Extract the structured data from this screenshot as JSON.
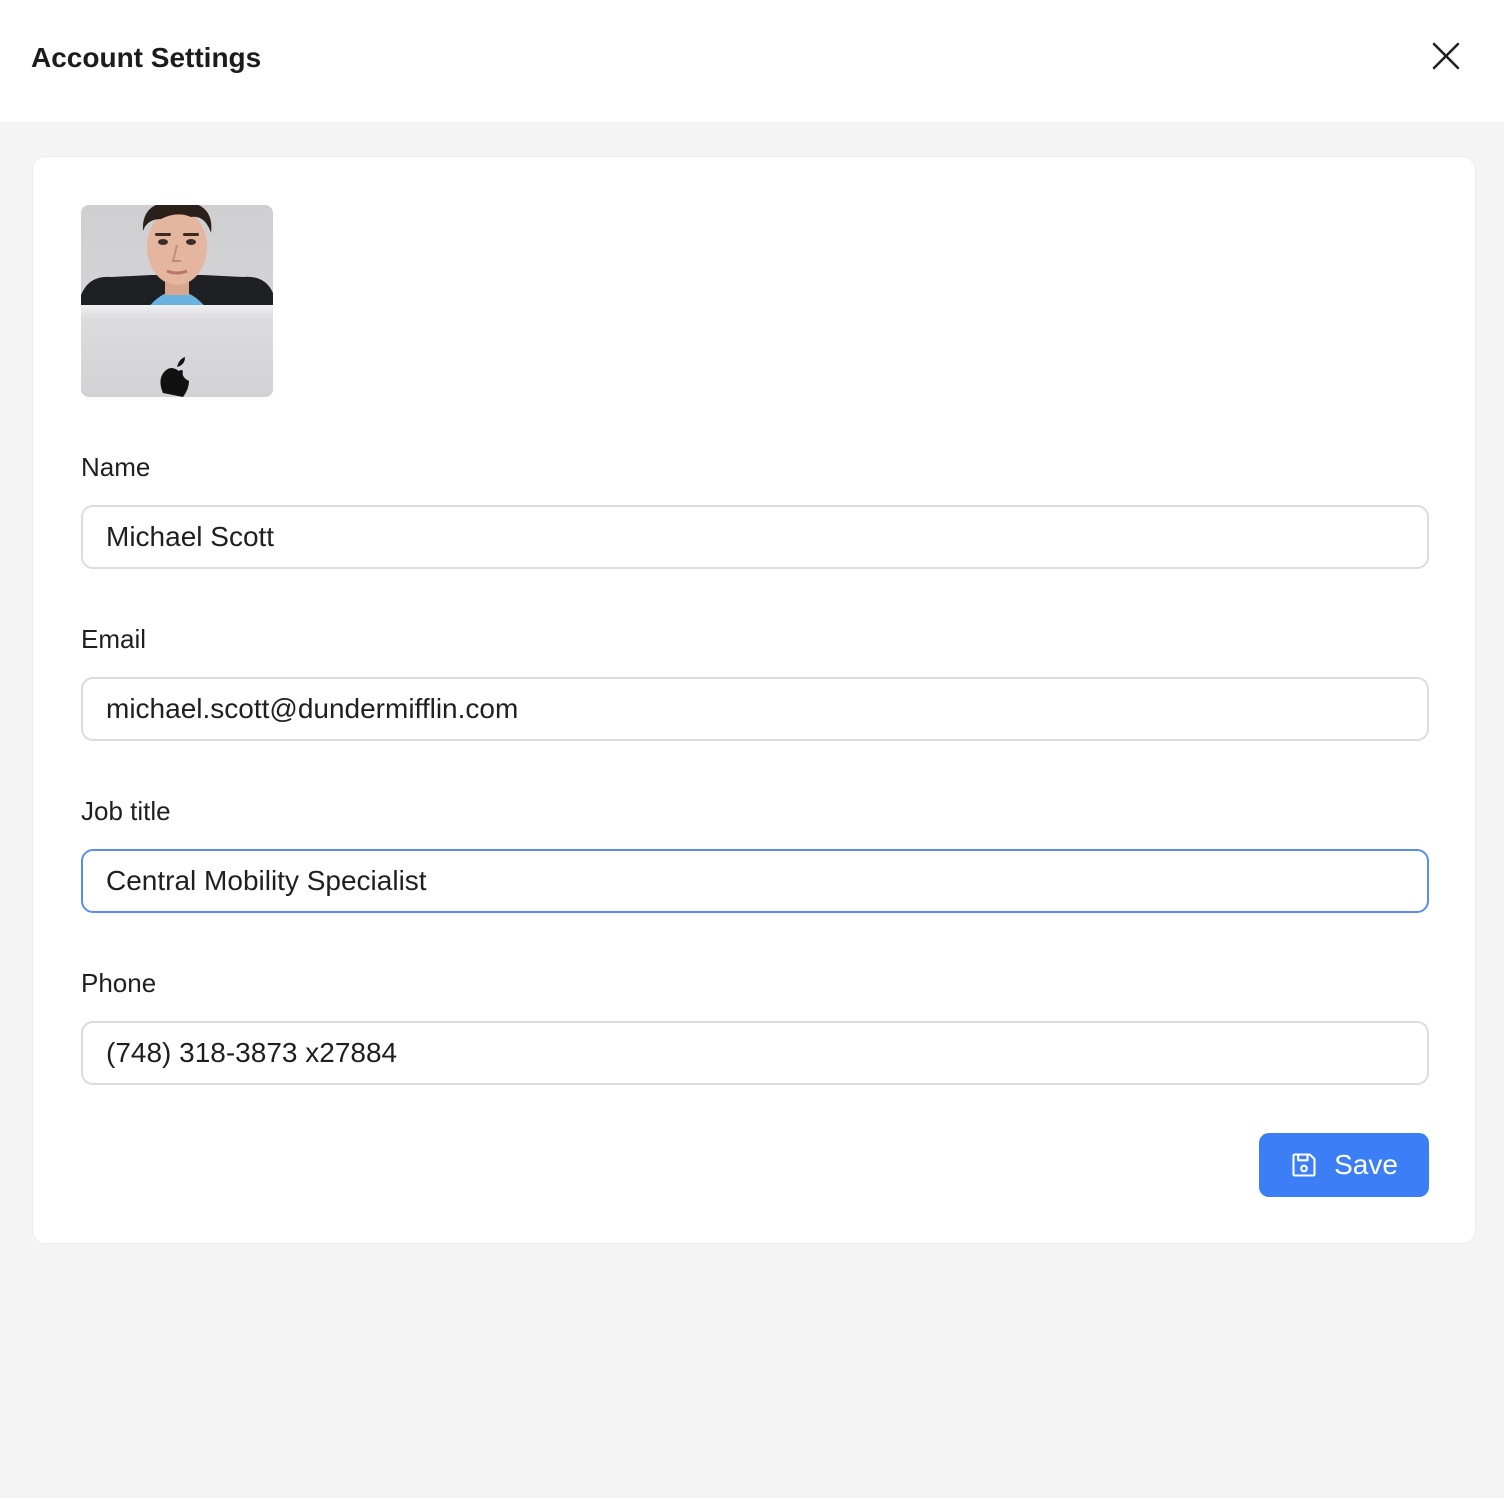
{
  "header": {
    "title": "Account Settings",
    "close_icon": "close-icon"
  },
  "profile": {
    "avatar_icon": "user-photo"
  },
  "fields": {
    "name": {
      "label": "Name",
      "value": "Michael Scott"
    },
    "email": {
      "label": "Email",
      "value": "michael.scott@dundermifflin.com"
    },
    "job_title": {
      "label": "Job title",
      "value": "Central Mobility Specialist"
    },
    "phone": {
      "label": "Phone",
      "value": "(748) 318-3873 x27884"
    }
  },
  "actions": {
    "save_label": "Save",
    "save_icon": "floppy-disk-icon"
  },
  "colors": {
    "accent": "#3b7ef5",
    "focus_border": "#5b8def",
    "background": "#f4f4f4"
  }
}
